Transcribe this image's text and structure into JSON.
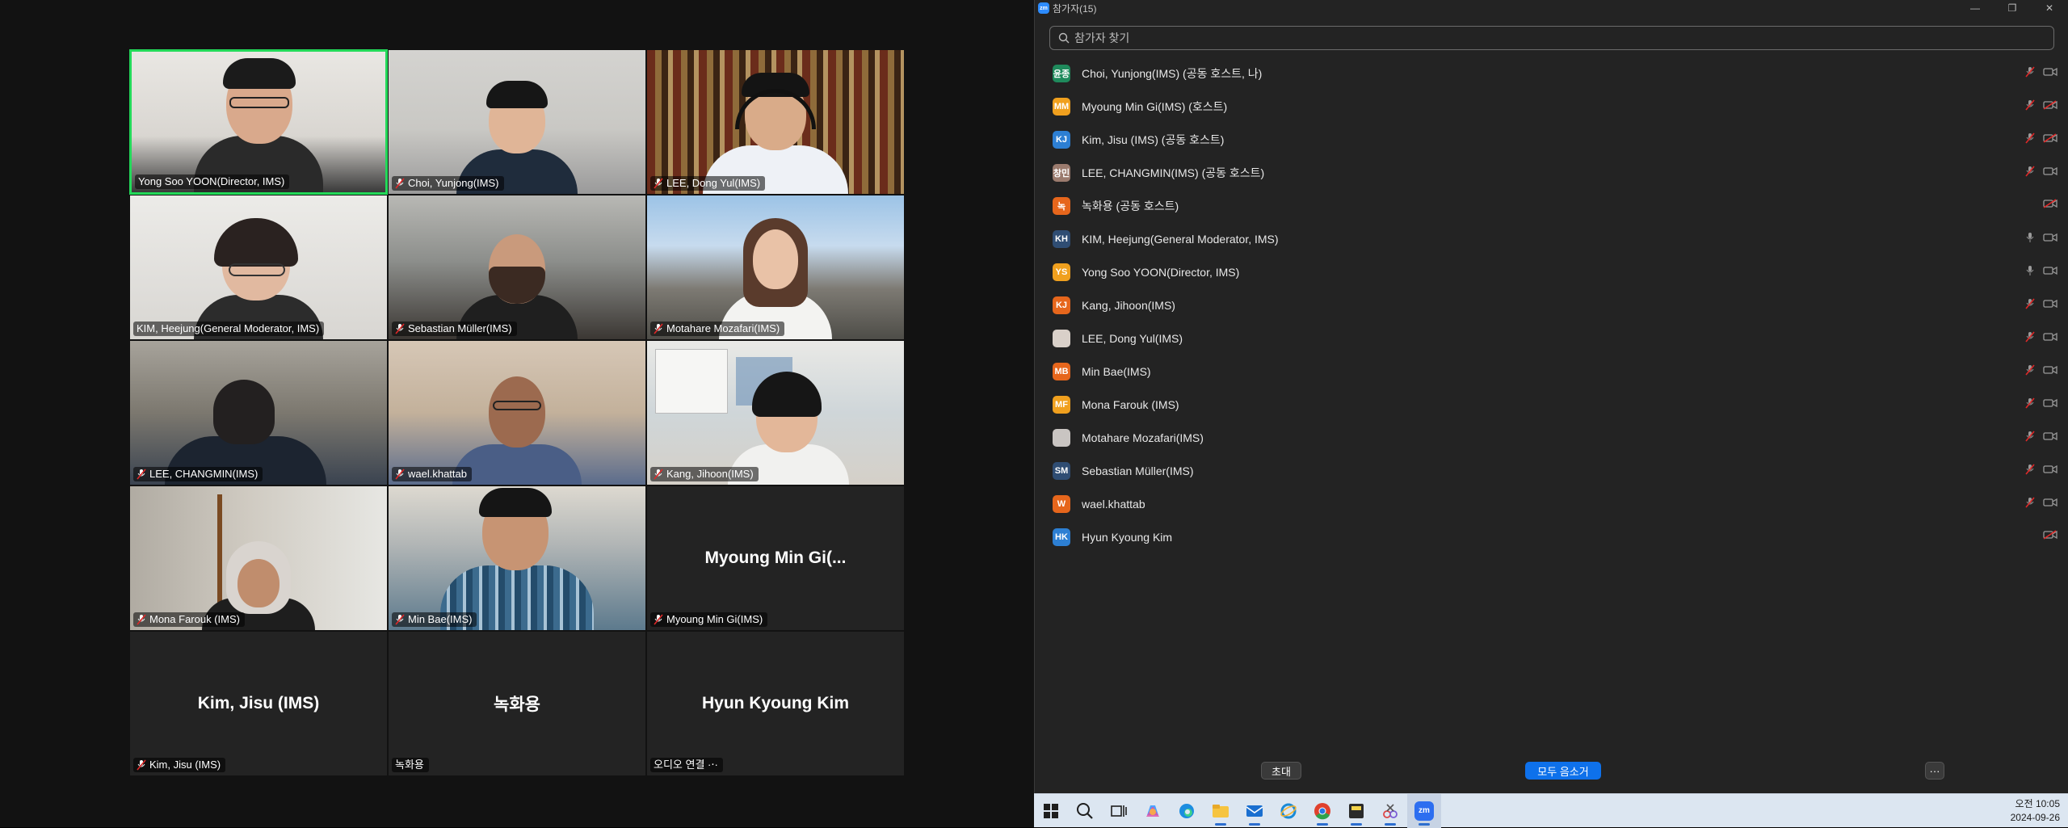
{
  "gallery": {
    "tiles": [
      {
        "name": "Yong Soo YOON(Director, IMS)",
        "muted": false
      },
      {
        "name": "Choi, Yunjong(IMS)",
        "muted": true
      },
      {
        "name": "LEE, Dong Yul(IMS)",
        "muted": true
      },
      {
        "name": "KIM, Heejung(General Moderator, IMS)",
        "muted": false
      },
      {
        "name": "Sebastian Müller(IMS)",
        "muted": true
      },
      {
        "name": "Motahare Mozafari(IMS)",
        "muted": true
      },
      {
        "name": "LEE, CHANGMIN(IMS)",
        "muted": true
      },
      {
        "name": "wael.khattab",
        "muted": true
      },
      {
        "name": "Kang, Jihoon(IMS)",
        "muted": true
      },
      {
        "name": "Mona Farouk (IMS)",
        "muted": true
      },
      {
        "name": "Min Bae(IMS)",
        "muted": true
      },
      {
        "name": "Myoung Min Gi(IMS)",
        "muted": true,
        "center": "Myoung Min Gi(..."
      },
      {
        "name": "Kim, Jisu (IMS)",
        "muted": true,
        "center": "Kim, Jisu (IMS)"
      },
      {
        "name": "녹화용",
        "muted": false,
        "center": "녹화용"
      },
      {
        "name": "오디오 연결 ·‧·",
        "muted": false,
        "center": "Hyun Kyoung Kim"
      }
    ]
  },
  "panel": {
    "title": "참가자(15)",
    "search_placeholder": "참가자 찾기",
    "participants": [
      {
        "initials": "윤종",
        "color": "#1f8a5c",
        "name": "Choi, Yunjong(IMS) (공동 호스트, 나)",
        "mic": "muted",
        "video": "on"
      },
      {
        "initials": "MM",
        "color": "#f0a01e",
        "name": "Myoung Min Gi(IMS) (호스트)",
        "mic": "muted",
        "video": "off"
      },
      {
        "initials": "KJ",
        "color": "#2d7fd3",
        "name": "Kim, Jisu (IMS) (공동 호스트)",
        "mic": "muted",
        "video": "off"
      },
      {
        "initials": "창민",
        "color": "#9b7b6e",
        "name": "LEE, CHANGMIN(IMS) (공동 호스트)",
        "mic": "muted",
        "video": "on"
      },
      {
        "initials": "녹",
        "color": "#e6661c",
        "name": "녹화용 (공동 호스트)",
        "mic": "none",
        "video": "off"
      },
      {
        "initials": "KH",
        "color": "#2f4d73",
        "name": "KIM, Heejung(General Moderator, IMS)",
        "mic": "on",
        "video": "on"
      },
      {
        "initials": "YS",
        "color": "#f0a01e",
        "name": "Yong Soo YOON(Director, IMS)",
        "mic": "on",
        "video": "on"
      },
      {
        "initials": "KJ",
        "color": "#e6661c",
        "name": "Kang, Jihoon(IMS)",
        "mic": "muted",
        "video": "on"
      },
      {
        "initials": "",
        "color": "#d9d0c9",
        "name": "LEE, Dong Yul(IMS)",
        "mic": "muted",
        "video": "on"
      },
      {
        "initials": "MB",
        "color": "#e6661c",
        "name": "Min Bae(IMS)",
        "mic": "muted",
        "video": "on"
      },
      {
        "initials": "MF",
        "color": "#f0a01e",
        "name": "Mona Farouk (IMS)",
        "mic": "muted",
        "video": "on"
      },
      {
        "initials": "",
        "color": "#c9c5c2",
        "name": "Motahare Mozafari(IMS)",
        "mic": "muted",
        "video": "on"
      },
      {
        "initials": "SM",
        "color": "#2f4d73",
        "name": "Sebastian Müller(IMS)",
        "mic": "muted",
        "video": "on"
      },
      {
        "initials": "W",
        "color": "#e6661c",
        "name": "wael.khattab",
        "mic": "muted",
        "video": "on"
      },
      {
        "initials": "HK",
        "color": "#2d7fd3",
        "name": "Hyun Kyoung Kim",
        "mic": "none",
        "video": "off"
      }
    ],
    "invite_label": "초대",
    "mute_all_label": "모두 음소거",
    "more_label": "···"
  },
  "taskbar": {
    "time": "오전 10:05",
    "date": "2024-09-26"
  }
}
